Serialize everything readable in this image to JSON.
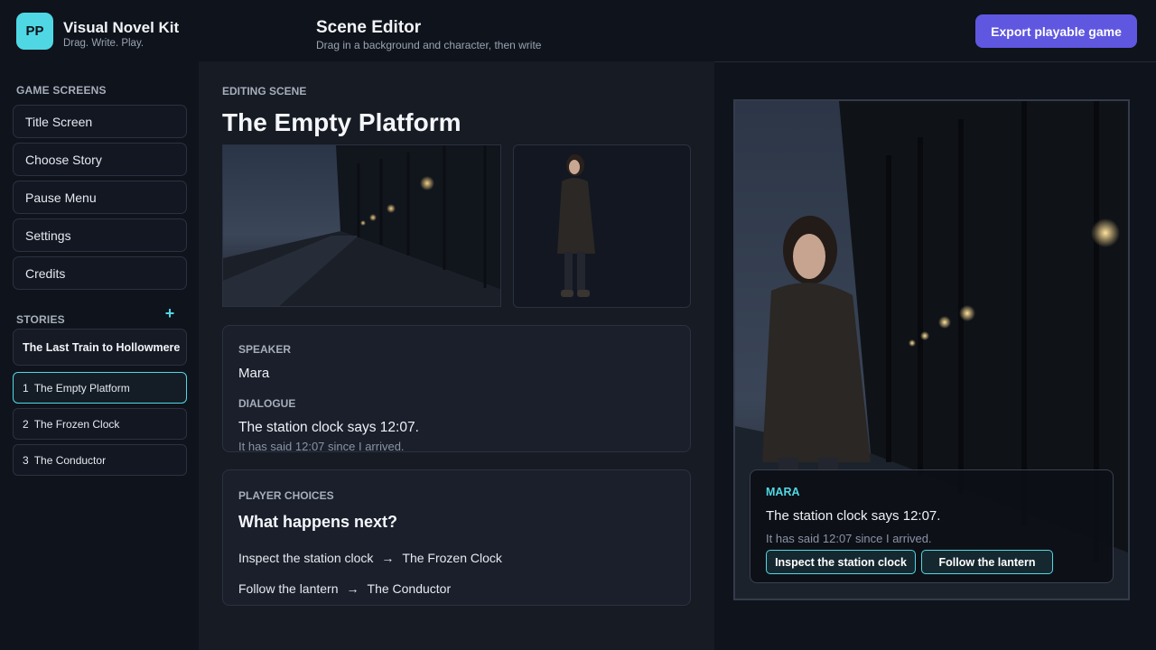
{
  "app": {
    "logo_initials": "PP",
    "name": "Visual Novel Kit",
    "tagline": "Drag. Write. Play."
  },
  "header": {
    "title": "Scene Editor",
    "subtitle": "Drag in a background and character, then write",
    "export_label": "Export playable game"
  },
  "sidebar": {
    "screens_label": "GAME SCREENS",
    "screens": [
      {
        "label": "Title Screen"
      },
      {
        "label": "Choose Story"
      },
      {
        "label": "Pause Menu"
      },
      {
        "label": "Settings"
      },
      {
        "label": "Credits"
      }
    ],
    "stories_label": "STORIES",
    "add_icon": "+",
    "story_title": "The Last Train to Hollowmere",
    "scenes": [
      {
        "num": "1",
        "label": "The Empty Platform",
        "active": true
      },
      {
        "num": "2",
        "label": "The Frozen Clock",
        "active": false
      },
      {
        "num": "3",
        "label": "The Conductor",
        "active": false
      }
    ]
  },
  "editor": {
    "editing_label": "EDITING SCENE",
    "scene_title": "The Empty Platform",
    "speaker_label": "SPEAKER",
    "speaker": "Mara",
    "dialogue_label": "DIALOGUE",
    "dialogue_line1": "The station clock says 12:07.",
    "dialogue_line2": "It has said 12:07 since I arrived.",
    "choices_label": "PLAYER CHOICES",
    "choices_question": "What happens next?",
    "choices": [
      {
        "text": "Inspect the station clock",
        "arrow": "→",
        "target": "The Frozen Clock"
      },
      {
        "text": "Follow the lantern",
        "arrow": "→",
        "target": "The Conductor"
      }
    ]
  },
  "preview": {
    "speaker": "MARA",
    "line1": "The station clock says 12:07.",
    "line2": "It has said 12:07 since I arrived.",
    "choice1": "Inspect the station clock",
    "choice2": "Follow the lantern"
  },
  "colors": {
    "accent": "#4fd8e4",
    "primary_button": "#5f57e0",
    "background": "#0f131b",
    "panel": "#1a1f2b"
  }
}
